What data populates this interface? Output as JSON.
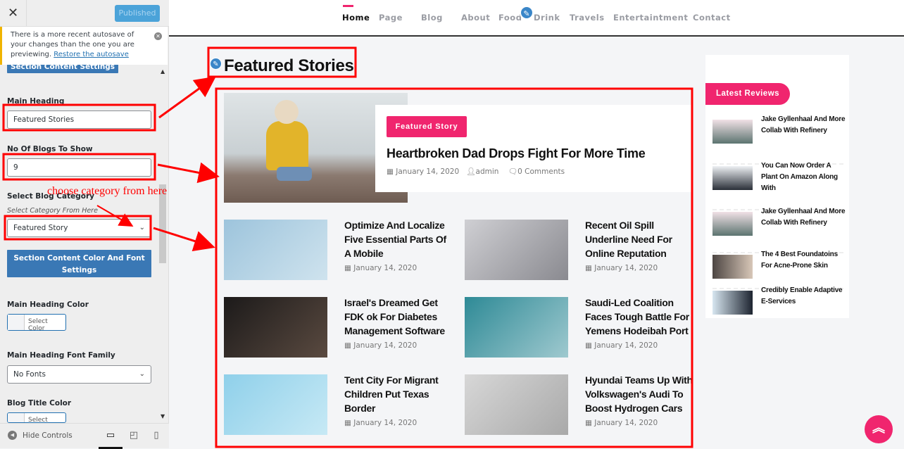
{
  "customizer": {
    "published_label": "Published",
    "notice_text": "There is a more recent autosave of your changes than the one you are previewing.",
    "notice_link": "Restore the autosave",
    "section_content_settings": "Section Content Settings",
    "main_heading_label": "Main Heading",
    "main_heading_value": "Featured Stories",
    "blogs_label": "No Of Blogs To Show",
    "blogs_value": "9",
    "category_label": "Select Blog Category",
    "category_sub": "Select Category From Here",
    "category_value": "Featured Story",
    "color_font_settings": "Section Content Color And Font Settings",
    "main_heading_color_label": "Main Heading Color",
    "select_color": "Select Color",
    "font_family_label": "Main Heading Font Family",
    "font_family_value": "No Fonts",
    "blog_title_color_label": "Blog Title Color",
    "hide_controls": "Hide Controls"
  },
  "annotation": {
    "text": "choose category from here",
    "color": "#ff0000"
  },
  "nav": [
    "Home",
    "Page",
    "Blog",
    "About",
    "Food",
    "Drink",
    "Travels",
    "Entertaintment",
    "Contact"
  ],
  "section_title": "Featured Stories",
  "featured": {
    "badge": "Featured Story",
    "title": "Heartbroken Dad Drops Fight For More Time",
    "date": "January 14, 2020",
    "author": "admin",
    "comments": "0 Comments"
  },
  "posts": [
    {
      "title": "Optimize And Localize Five Essential Parts Of A Mobile",
      "date": "January 14, 2020"
    },
    {
      "title": "Recent Oil Spill Underline Need For Online Reputation",
      "date": "January 14, 2020"
    },
    {
      "title": "Israel's Dreamed Get FDK ok For Diabetes Management Software",
      "date": "January 14, 2020"
    },
    {
      "title": "Saudi-Led Coalition Faces Tough Battle For Yemens Hodeibah Port",
      "date": "January 14, 2020"
    },
    {
      "title": "Tent City For Migrant Children Put Texas Border",
      "date": "January 14, 2020"
    },
    {
      "title": "Hyundai Teams Up With Volkswagen's Audi To Boost Hydrogen Cars",
      "date": "January 14, 2020"
    }
  ],
  "latest_reviews": {
    "title": "Latest Reviews",
    "items": [
      "Jake Gyllenhaal And More Collab With Refinery",
      "You Can Now Order A Plant On Amazon Along With",
      "Jake Gyllenhaal And More Collab With Refinery",
      "The 4 Best Foundatoins For Acne-Prone Skin",
      "Credibly Enable Adaptive E-Services"
    ]
  },
  "colors": {
    "accent": "#f0256e",
    "customizer_blue": "#3a78b5",
    "annotation_red": "#ff0000"
  }
}
